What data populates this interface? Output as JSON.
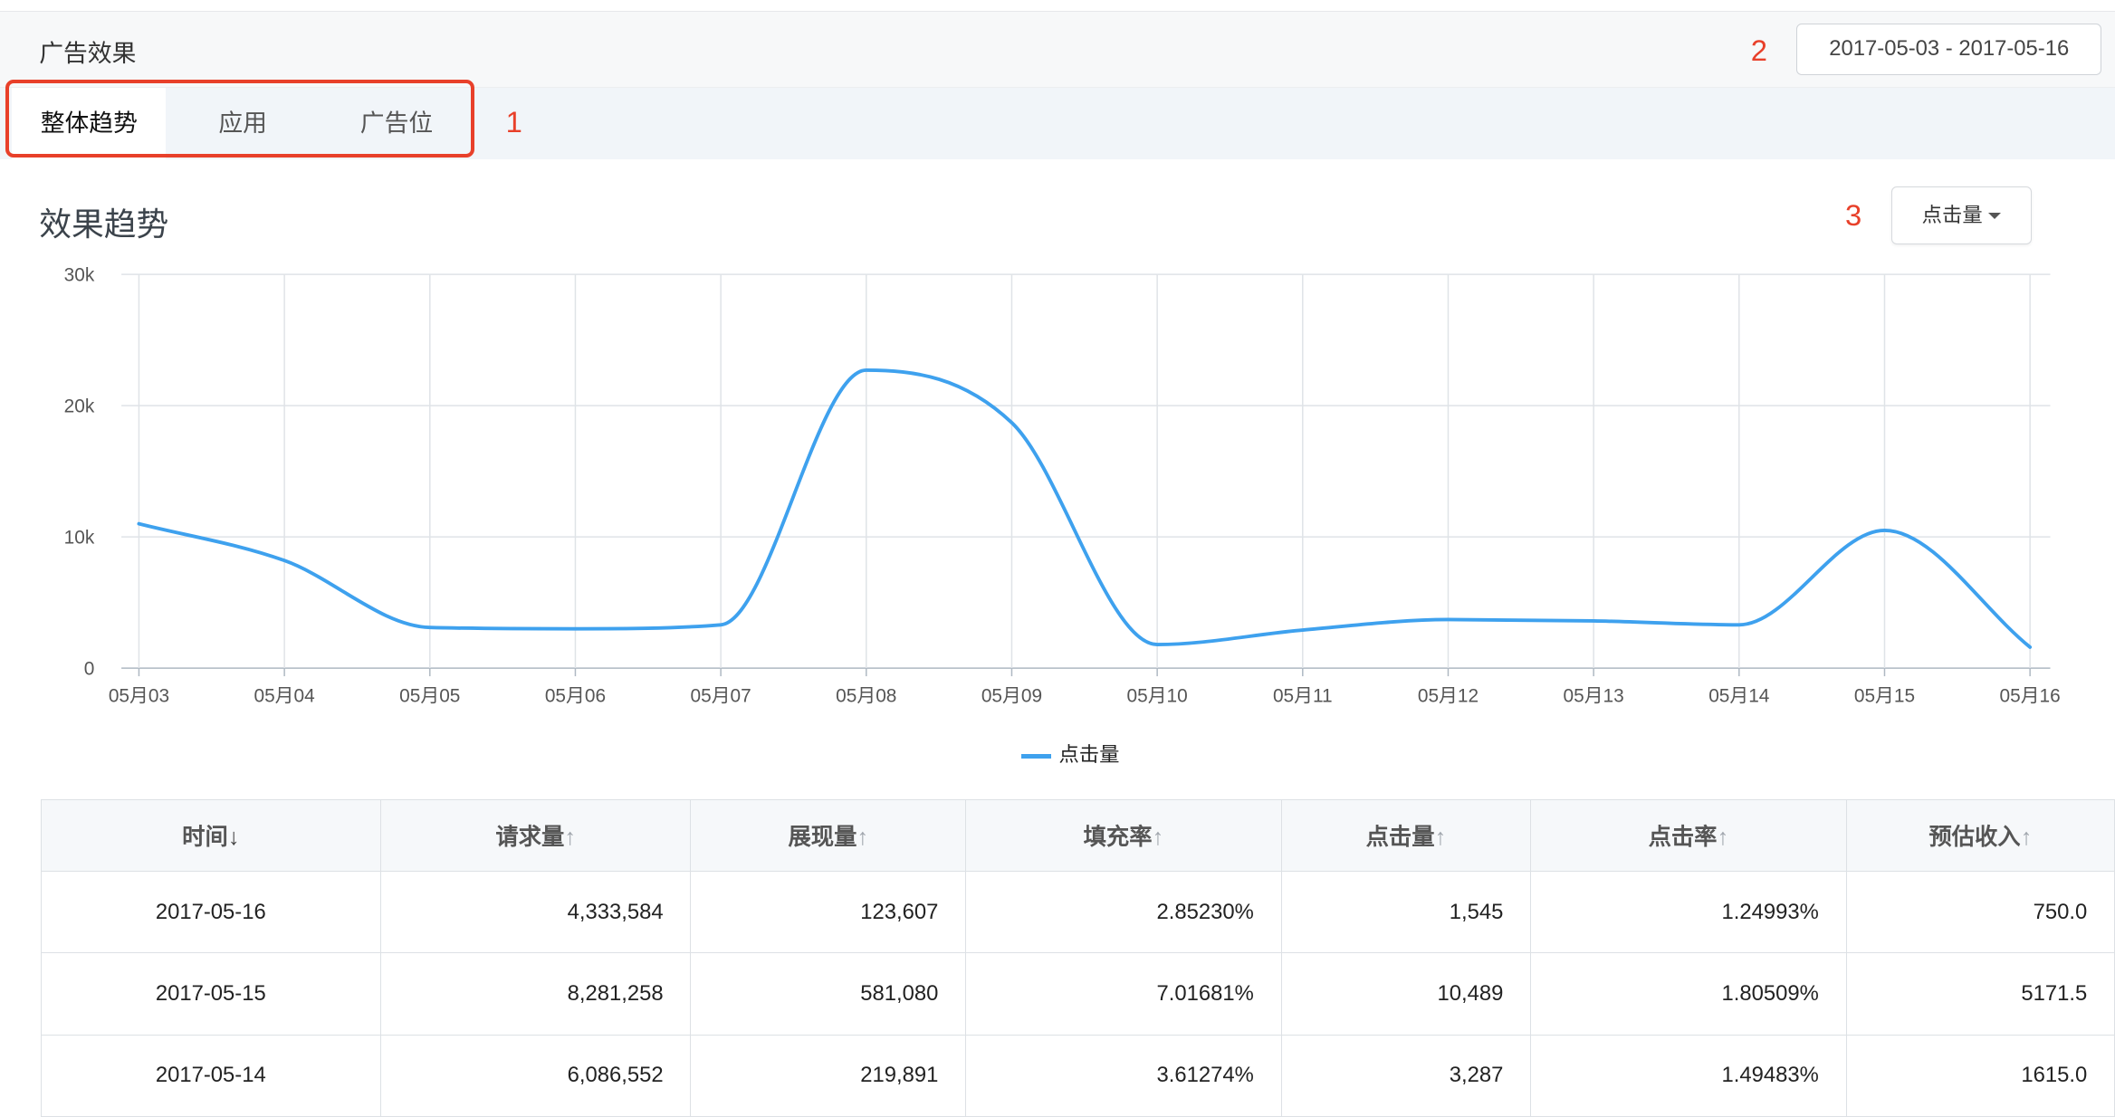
{
  "header": {
    "title": "广告效果",
    "date_range": "2017-05-03 - 2017-05-16"
  },
  "annotations": [
    "1",
    "2",
    "3"
  ],
  "tabs": [
    {
      "label": "整体趋势",
      "active": true
    },
    {
      "label": "应用",
      "active": false
    },
    {
      "label": "广告位",
      "active": false
    }
  ],
  "section": {
    "title": "效果趋势",
    "metric_select": "点击量"
  },
  "chart_data": {
    "type": "line",
    "x": [
      "05月03",
      "05月04",
      "05月05",
      "05月06",
      "05月07",
      "05月08",
      "05月09",
      "05月10",
      "05月11",
      "05月12",
      "05月13",
      "05月14",
      "05月15",
      "05月16"
    ],
    "series": [
      {
        "name": "点击量",
        "color": "#3ea1ee",
        "values": [
          11000,
          8200,
          3100,
          3000,
          3300,
          22700,
          18700,
          1800,
          2900,
          3700,
          3600,
          3300,
          10500,
          1600
        ]
      }
    ],
    "yticks": [
      "0",
      "10k",
      "20k",
      "30k"
    ],
    "ylim": [
      0,
      30000
    ],
    "grid": true,
    "legend": "bottom-center"
  },
  "table": {
    "columns": [
      {
        "label": "时间",
        "sort": "↓",
        "active": true
      },
      {
        "label": "请求量",
        "sort": "↑",
        "active": false
      },
      {
        "label": "展现量",
        "sort": "↑",
        "active": false
      },
      {
        "label": "填充率",
        "sort": "↑",
        "active": false
      },
      {
        "label": "点击量",
        "sort": "↑",
        "active": false
      },
      {
        "label": "点击率",
        "sort": "↑",
        "active": false
      },
      {
        "label": "预估收入",
        "sort": "↑",
        "active": false
      }
    ],
    "rows": [
      [
        "2017-05-16",
        "4,333,584",
        "123,607",
        "2.85230%",
        "1,545",
        "1.24993%",
        "750.0"
      ],
      [
        "2017-05-15",
        "8,281,258",
        "581,080",
        "7.01681%",
        "10,489",
        "1.80509%",
        "5171.5"
      ],
      [
        "2017-05-14",
        "6,086,552",
        "219,891",
        "3.61274%",
        "3,287",
        "1.49483%",
        "1615.0"
      ]
    ]
  }
}
